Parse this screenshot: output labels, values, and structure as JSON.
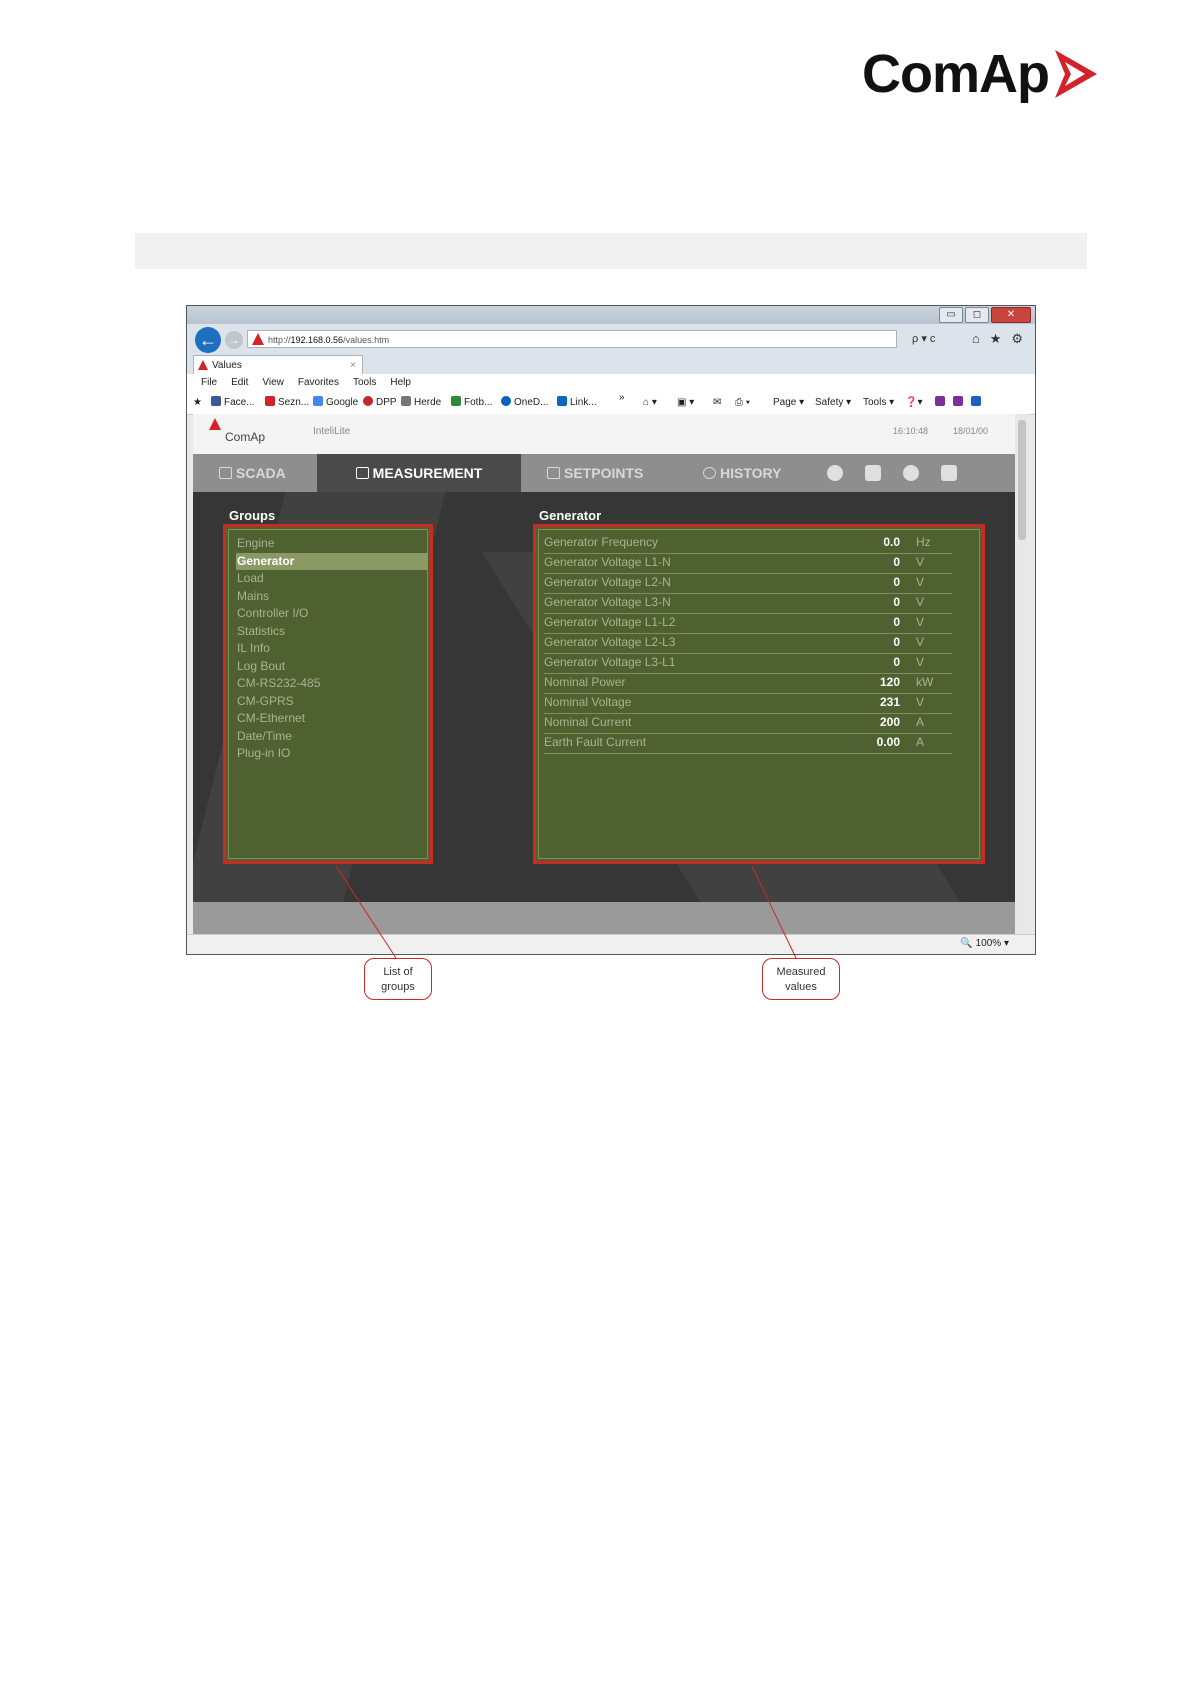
{
  "header": {
    "brand": "ComAp",
    "brand_color": "#d2232a"
  },
  "browser": {
    "url_prefix": "http://",
    "url_host": "192.168.0.56",
    "url_path": "/values.htm",
    "address_controls": "ρ ▾ c",
    "tab_title": "Values",
    "tab_close": "×",
    "window_buttons": [
      "▭",
      "◻",
      "✕"
    ],
    "menu": [
      "File",
      "Edit",
      "View",
      "Favorites",
      "Tools",
      "Help"
    ],
    "favorites": [
      {
        "label": "Face...",
        "icon": "facebook-icon"
      },
      {
        "label": "Sezn...",
        "icon": "seznam-icon"
      },
      {
        "label": "Google",
        "icon": "google-icon"
      },
      {
        "label": "DPP",
        "icon": "dpp-icon"
      },
      {
        "label": "Herde",
        "icon": "herde-icon"
      },
      {
        "label": "Fotb...",
        "icon": "fotbal-icon"
      },
      {
        "label": "OneD...",
        "icon": "onedrive-icon"
      },
      {
        "label": "Link...",
        "icon": "linkedin-icon"
      }
    ],
    "overflow_chevron": "»",
    "command_bar": [
      "Page ▾",
      "Safety ▾",
      "Tools ▾"
    ],
    "zoom": "100%"
  },
  "app": {
    "logo": "ComAp",
    "model": "InteliLite",
    "time": "16:10:48",
    "date": "18/01/00",
    "nav": {
      "scada": "SCADA",
      "measurement": "MEASUREMENT",
      "setpoints": "SETPOINTS",
      "history": "HISTORY"
    },
    "groups_title": "Groups",
    "groups": [
      "Engine",
      "Generator",
      "Load",
      "Mains",
      "Controller I/O",
      "Statistics",
      "IL Info",
      "Log Bout",
      "CM-RS232-485",
      "CM-GPRS",
      "CM-Ethernet",
      "Date/Time",
      "Plug-in IO"
    ],
    "selected_group": "Generator",
    "values_title": "Generator",
    "values": [
      {
        "name": "Generator Frequency",
        "value": "0.0",
        "unit": "Hz"
      },
      {
        "name": "Generator Voltage L1-N",
        "value": "0",
        "unit": "V"
      },
      {
        "name": "Generator Voltage L2-N",
        "value": "0",
        "unit": "V"
      },
      {
        "name": "Generator Voltage L3-N",
        "value": "0",
        "unit": "V"
      },
      {
        "name": "Generator Voltage L1-L2",
        "value": "0",
        "unit": "V"
      },
      {
        "name": "Generator Voltage L2-L3",
        "value": "0",
        "unit": "V"
      },
      {
        "name": "Generator Voltage L3-L1",
        "value": "0",
        "unit": "V"
      },
      {
        "name": "Nominal Power",
        "value": "120",
        "unit": "kW"
      },
      {
        "name": "Nominal Voltage",
        "value": "231",
        "unit": "V"
      },
      {
        "name": "Nominal Current",
        "value": "200",
        "unit": "A"
      },
      {
        "name": "Earth Fault Current",
        "value": "0.00",
        "unit": "A"
      }
    ]
  },
  "callouts": {
    "groups_line1": "List of",
    "groups_line2": "groups",
    "values_line1": "Measured",
    "values_line2": "values"
  },
  "colors": {
    "highlight": "#c92b24",
    "panel": "#4f6130",
    "nav_active": "#4a4a4a"
  }
}
